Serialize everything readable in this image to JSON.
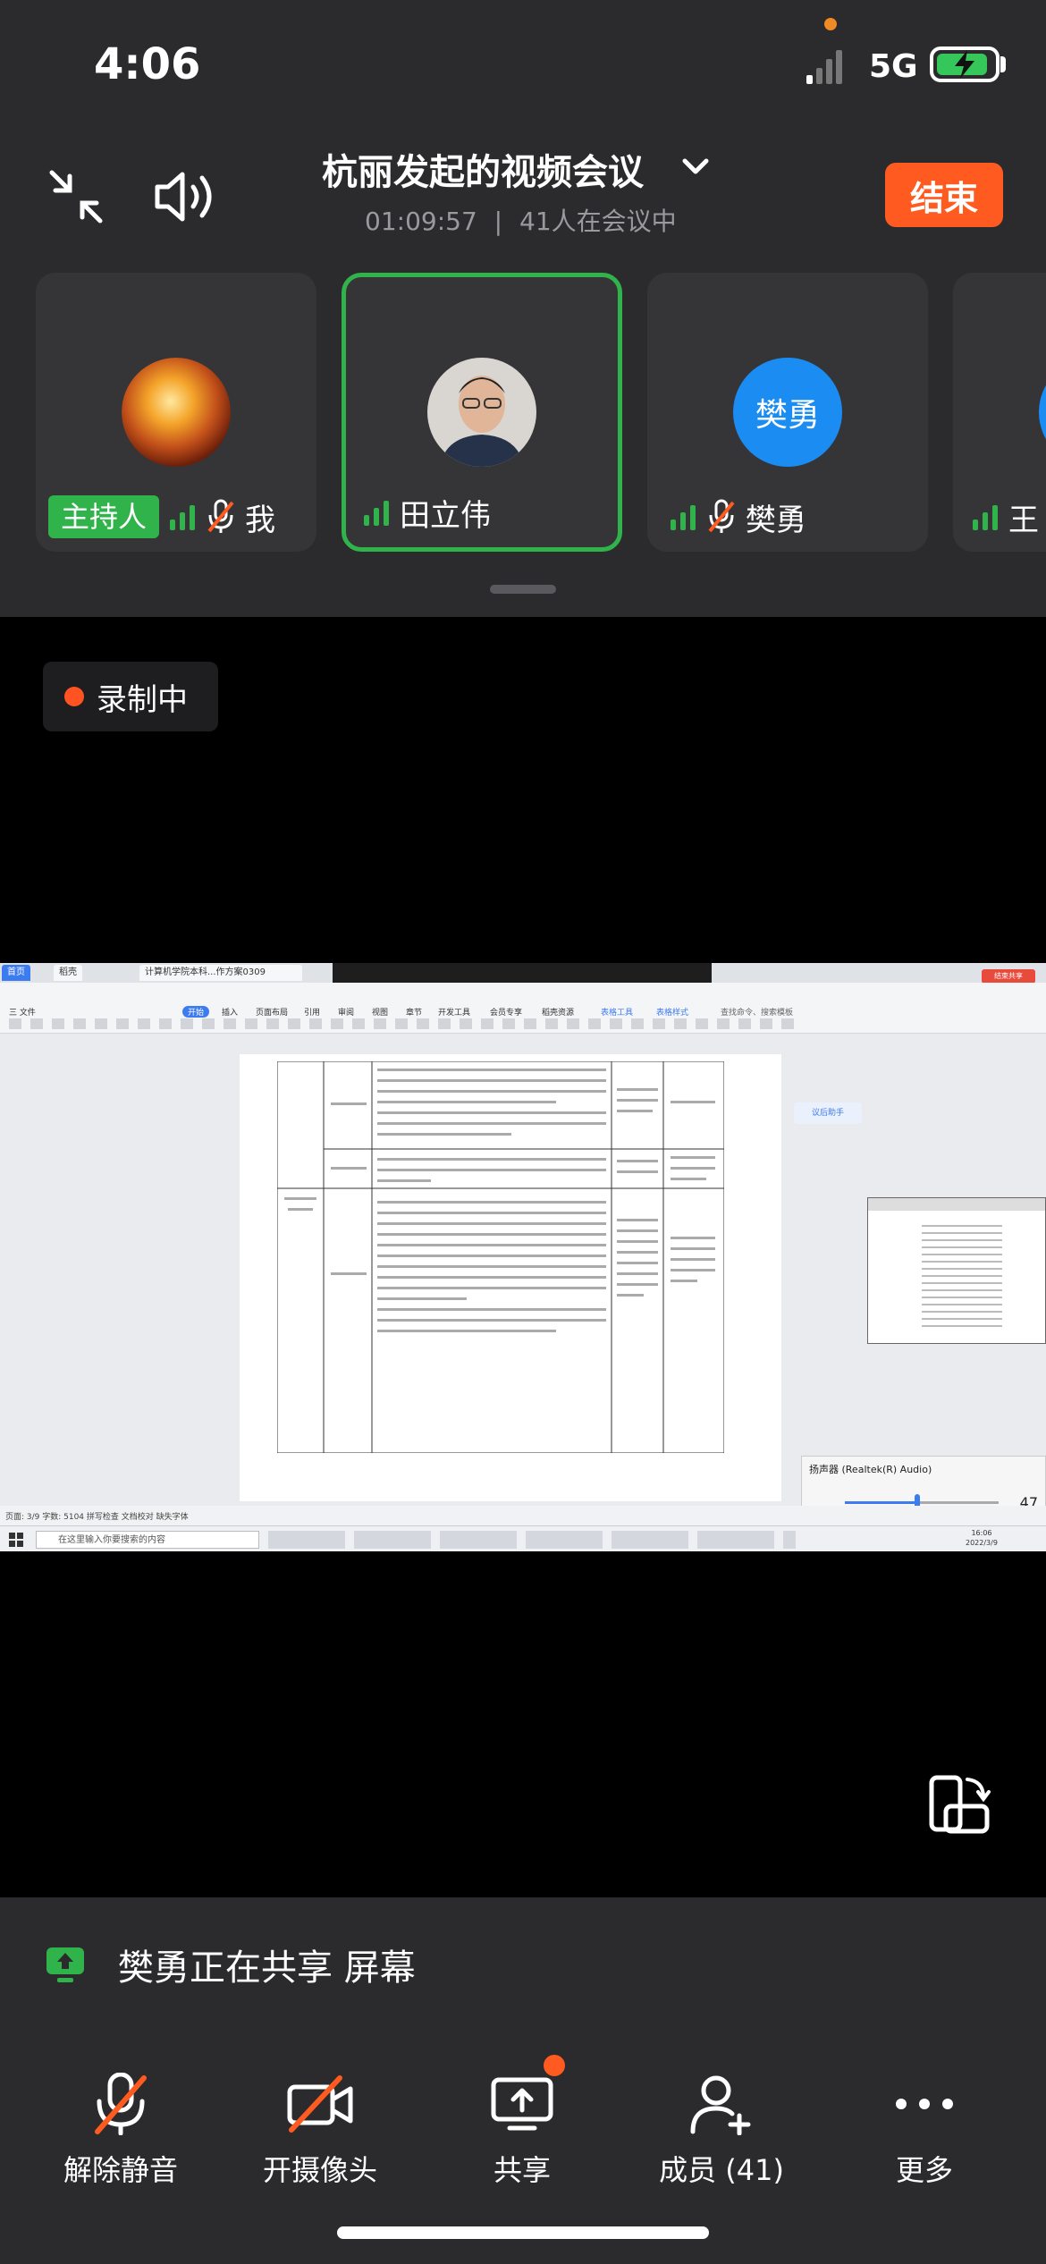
{
  "status_bar": {
    "time": "4:06",
    "network": "5G"
  },
  "meeting": {
    "title": "杭丽发起的视频会议",
    "duration": "01:09:57",
    "separator": "|",
    "participants_text": "41人在会议中",
    "end_label": "结束"
  },
  "participants": [
    {
      "name": "我",
      "host_label": "主持人"
    },
    {
      "name": "田立伟"
    },
    {
      "name": "樊勇",
      "avatar_text": "樊勇"
    },
    {
      "name": "王"
    }
  ],
  "recording": {
    "label": "录制中"
  },
  "shared_screen": {
    "tabs": [
      "首页",
      "稻壳",
      "计算机学院本科...作方案0309"
    ],
    "menu": [
      "三 文件",
      "开始",
      "插入",
      "页面布局",
      "引用",
      "审阅",
      "视图",
      "章节",
      "开发工具",
      "会员专享",
      "稻壳资源",
      "表格工具",
      "表格样式"
    ],
    "search_placeholder": "查找命令、搜索模板",
    "table_rows": [
      {
        "date": "2022. 3-2022. 12",
        "content": "教育。加强师德宣传，严格考核管理，加强制度建设，落实师德考核贯穿于教育教学全过程等方面的情况",
        "output": "师德考核方案、新闻报道",
        "person": "田立伟"
      },
      {
        "date": "2022. 3-2022. 12",
        "content": "实施“以学为中心、以教为主导”的课堂教学，开展以学生学习成果为导向的教学评价情况。",
        "output": "督导评价反馈记录表",
        "person": "戴永、李雪梅、樊吉、马丽君"
      },
      {
        "category": "自评自建自评",
        "date": "2022. 3-2022. 06",
        "content": "1.组织各专业进行人才培养方案修订工作。培养目标符合学校定位，适应社会经济发展需要；体现学生德智体美劳全面发展情况；符合国家专业类标准、体现产出导向理念。2.各教研室完成专业课程教学大纲制（修）订工作。3.对各门课程进行课程教案的修订，推进信息技术与教学过程融合。",
        "output": "会议记录、照片（委员会、教研室）、人才培养方案汇编、课程教学大纲汇编。",
        "person": "樊勇、谢各、各专业建设负责人、教研室主任"
      }
    ],
    "assistant_label": "议后助手",
    "status_text": "页面: 3/9  字数: 5104  拼写检查  文档校对  缺失字体",
    "taskbar_search": "在这里输入你要搜索的内容",
    "volume_title": "扬声器 (Realtek(R) Audio)",
    "volume_value": 47,
    "volume_level": 0.47,
    "clock_time": "16:06",
    "clock_date": "2022/3/9",
    "meeting_bar_end": "结束共享"
  },
  "share_notice": {
    "sharer": "樊勇",
    "text": "正在共享 屏幕"
  },
  "controls": [
    {
      "label": "解除静音"
    },
    {
      "label": "开摄像头"
    },
    {
      "label": "共享"
    },
    {
      "label": "成员 (41)"
    },
    {
      "label": "更多"
    }
  ],
  "colors": {
    "accent_green": "#2fb34a",
    "end_orange": "#ff5a1f",
    "avatar_blue": "#1b8cf2",
    "battery_green": "#35c75a"
  }
}
